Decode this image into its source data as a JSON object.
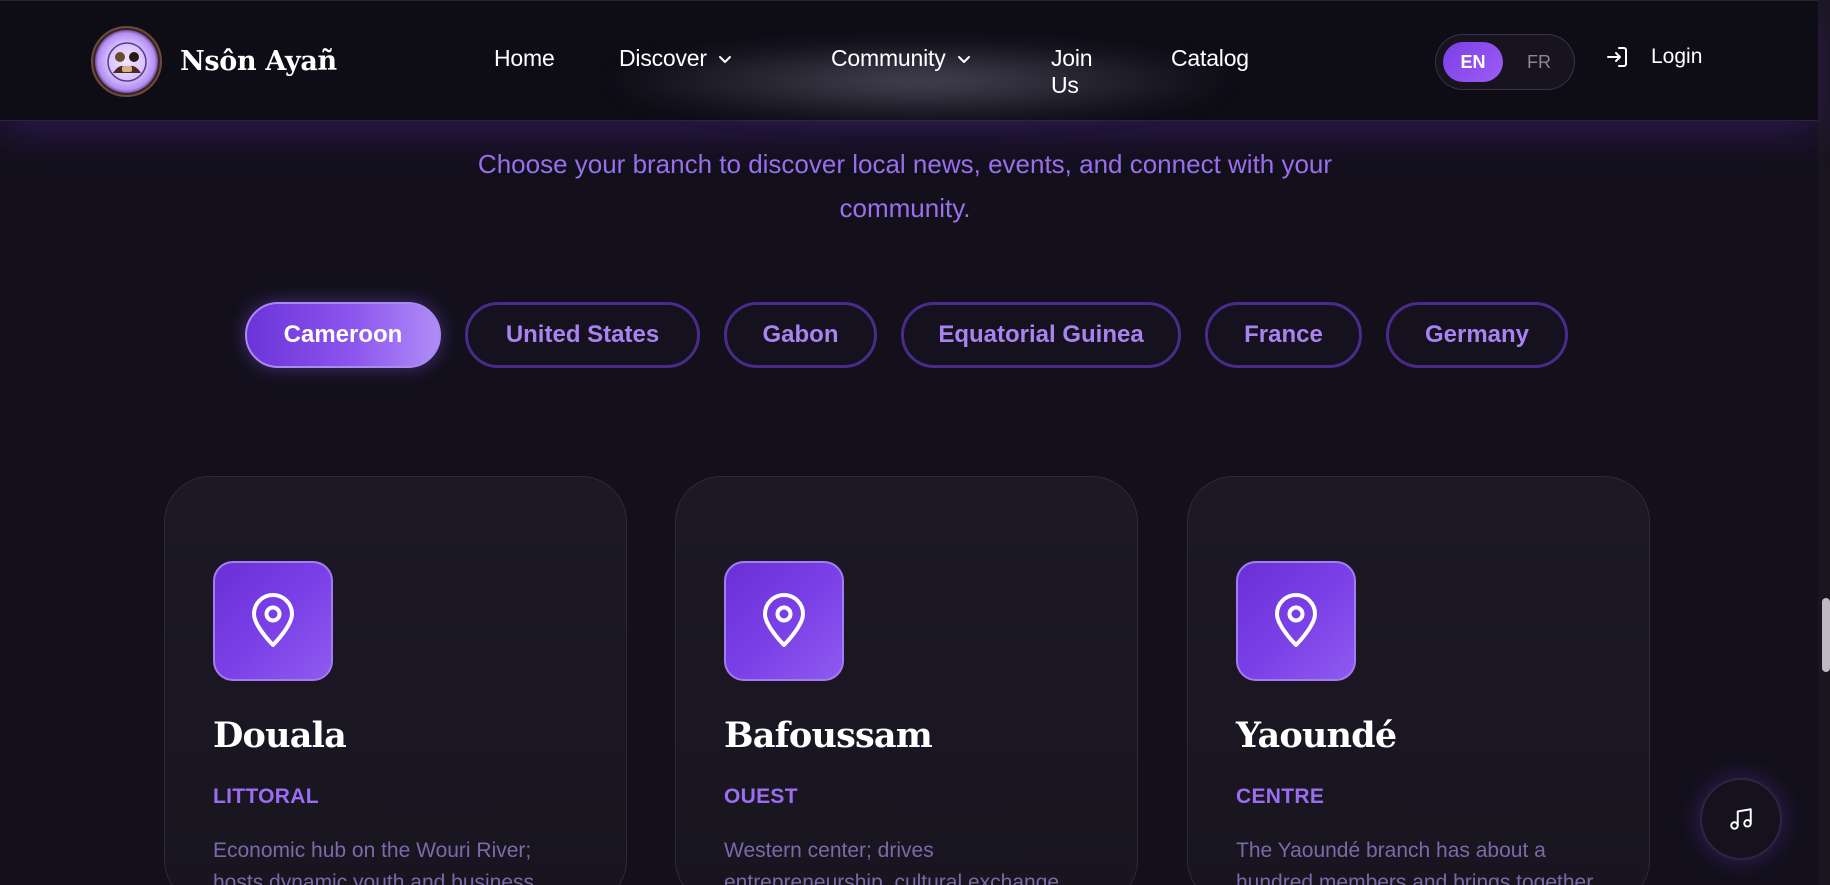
{
  "brand": {
    "name": "Nsôn Ayañ"
  },
  "nav": {
    "items": [
      {
        "label": "Home",
        "has_dropdown": false
      },
      {
        "label": "Discover",
        "has_dropdown": true
      },
      {
        "label": "Community",
        "has_dropdown": true
      },
      {
        "label": "Join Us",
        "has_dropdown": false
      },
      {
        "label": "Catalog",
        "has_dropdown": false
      }
    ]
  },
  "language": {
    "options": [
      "EN",
      "FR"
    ],
    "selected": "EN"
  },
  "login": {
    "label": "Login",
    "icon": "login-icon"
  },
  "intro": {
    "text": "Choose your branch to discover local news, events, and connect with your community."
  },
  "countries": {
    "items": [
      "Cameroon",
      "United States",
      "Gabon",
      "Equatorial Guinea",
      "France",
      "Germany"
    ],
    "selected": "Cameroon"
  },
  "branches": [
    {
      "city": "Douala",
      "region": "LITTORAL",
      "description": "Economic hub on the Wouri River; hosts dynamic youth and business",
      "icon": "map-pin-icon"
    },
    {
      "city": "Bafoussam",
      "region": "OUEST",
      "description": "Western center; drives entrepreneurship, cultural exchange",
      "icon": "map-pin-icon"
    },
    {
      "city": "Yaoundé",
      "region": "CENTRE",
      "description": "The Yaoundé branch has about a hundred members and brings together",
      "icon": "map-pin-icon"
    }
  ],
  "music": {
    "icon": "music-note-icon"
  },
  "colors": {
    "background": "#13101c",
    "header": "#0e0c15",
    "accent": "#7b3fe4",
    "accent_light": "#a983f0",
    "card": "#1c1826"
  }
}
